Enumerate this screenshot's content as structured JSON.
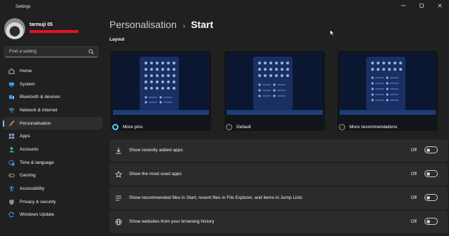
{
  "window": {
    "title": "Settings",
    "controls": [
      "minimize-icon",
      "maximize-icon",
      "close-icon"
    ]
  },
  "profile": {
    "name": "tarmuji 05",
    "email_redaction_color": "#e81123"
  },
  "search": {
    "placeholder": "Find a setting",
    "icon": "search-icon"
  },
  "nav": {
    "items": [
      {
        "label": "Home",
        "icon": "home-icon",
        "color": "#c8c8c8"
      },
      {
        "label": "System",
        "icon": "system-icon",
        "color": "#3b9cff"
      },
      {
        "label": "Bluetooth & devices",
        "icon": "bluetooth-icon",
        "color": "#3b9cff"
      },
      {
        "label": "Network & internet",
        "icon": "wifi-icon",
        "color": "#62c3ff"
      },
      {
        "label": "Personalisation",
        "icon": "brush-icon",
        "color": "#f0a060",
        "active": true
      },
      {
        "label": "Apps",
        "icon": "apps-icon",
        "color": "#8ba7c7"
      },
      {
        "label": "Accounts",
        "icon": "account-icon",
        "color": "#2fbf71"
      },
      {
        "label": "Time & language",
        "icon": "globe-clock-icon",
        "color": "#3b9cff"
      },
      {
        "label": "Gaming",
        "icon": "gamepad-icon",
        "color": "#9a9a9a"
      },
      {
        "label": "Accessibility",
        "icon": "accessibility-icon",
        "color": "#3b9cff"
      },
      {
        "label": "Privacy & security",
        "icon": "shield-icon",
        "color": "#9a9a9a"
      },
      {
        "label": "Windows Update",
        "icon": "update-icon",
        "color": "#3b9cff"
      }
    ]
  },
  "header": {
    "parent": "Personalisation",
    "separator": "›",
    "current": "Start"
  },
  "layout": {
    "label": "Layout",
    "options": [
      {
        "label": "More pins",
        "selected": true,
        "icon": "layout-more-pins-preview"
      },
      {
        "label": "Default",
        "selected": false,
        "icon": "layout-default-preview"
      },
      {
        "label": "More recommendations",
        "selected": false,
        "icon": "layout-more-recommendations-preview"
      }
    ]
  },
  "settings": [
    {
      "label": "Show recently added apps",
      "state": "Off",
      "icon": "download-icon"
    },
    {
      "label": "Show the most used apps",
      "state": "Off",
      "icon": "star-icon"
    },
    {
      "label": "Show recommended files in Start, recent files in File Explorer, and items in Jump Lists",
      "state": "Off",
      "icon": "list-icon"
    },
    {
      "label": "Show websites from your browsing history",
      "state": "Off",
      "icon": "globe-icon"
    }
  ],
  "colors": {
    "background": "#202020",
    "card": "#2b2b2b",
    "accent": "#60cdff"
  }
}
